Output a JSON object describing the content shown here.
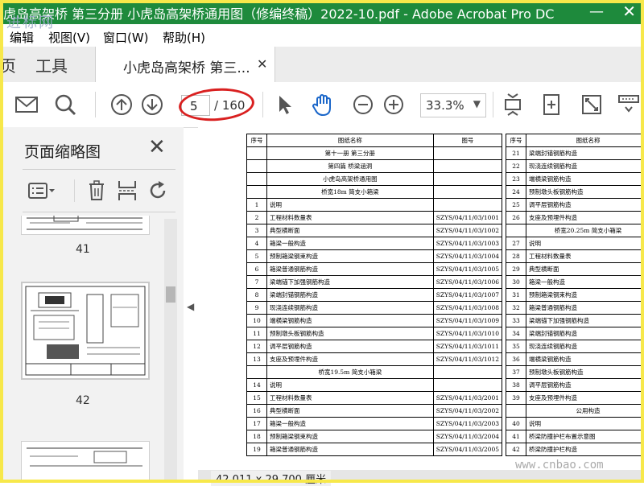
{
  "window": {
    "title": "虎岛高架桥 第三分册 小虎岛高架桥通用图（修编终稿）2022-10.pdf - Adobe Acrobat Pro DC",
    "watermark": "进标网"
  },
  "menu": [
    "编辑",
    "视图(V)",
    "窗口(W)",
    "帮助(H)"
  ],
  "tabs": {
    "home_fragment": "页",
    "tools": "工具",
    "document": "小虎岛高架桥 第三..."
  },
  "toolbar": {
    "page_current": "5",
    "page_total": "/ 160",
    "zoom": "33.3%"
  },
  "sidebar": {
    "title": "页面缩略图",
    "thumbnails": [
      "41",
      "42"
    ]
  },
  "document": {
    "header": "图纸名称",
    "header_code": "图号",
    "header_seq": "序号",
    "left_rows": [
      {
        "seq": "",
        "name": "第十一册  第三分册",
        "code": "",
        "bold": true
      },
      {
        "seq": "",
        "name": "第四篇  桥梁涵洞",
        "code": "",
        "bold": true
      },
      {
        "seq": "",
        "name": "小虎岛高架桥通用图",
        "code": "",
        "bold": true
      },
      {
        "seq": "",
        "name": "桥宽18m 简支小箱梁",
        "code": "",
        "bold": true
      },
      {
        "seq": "1",
        "name": "说明",
        "code": ""
      },
      {
        "seq": "2",
        "name": "工程材料数量表",
        "code": "SZYS/04/11/03/1001"
      },
      {
        "seq": "3",
        "name": "典型横断面",
        "code": "SZYS/04/11/03/1002"
      },
      {
        "seq": "4",
        "name": "箱梁一般构造",
        "code": "SZYS/04/11/03/1003"
      },
      {
        "seq": "5",
        "name": "预制箱梁钢束构造",
        "code": "SZYS/04/11/03/1004"
      },
      {
        "seq": "6",
        "name": "箱梁普通钢筋构造",
        "code": "SZYS/04/11/03/1005"
      },
      {
        "seq": "7",
        "name": "梁端锚下加强钢筋构造",
        "code": "SZYS/04/11/03/1006"
      },
      {
        "seq": "8",
        "name": "梁端封锚钢筋构造",
        "code": "SZYS/04/11/03/1007"
      },
      {
        "seq": "9",
        "name": "现浇连续钢筋构造",
        "code": "SZYS/04/11/03/1008"
      },
      {
        "seq": "10",
        "name": "端横梁钢筋构造",
        "code": "SZYS/04/11/03/1009"
      },
      {
        "seq": "11",
        "name": "预制墩头板钢筋构造",
        "code": "SZYS/04/11/03/1010"
      },
      {
        "seq": "12",
        "name": "调平层钢筋构造",
        "code": "SZYS/04/11/03/1011"
      },
      {
        "seq": "13",
        "name": "支座及预埋件构造",
        "code": "SZYS/04/11/03/1012"
      },
      {
        "seq": "",
        "name": "桥宽19.5m 简支小箱梁",
        "code": "",
        "bold": true
      },
      {
        "seq": "14",
        "name": "说明",
        "code": ""
      },
      {
        "seq": "15",
        "name": "工程材料数量表",
        "code": "SZYS/04/11/03/2001"
      },
      {
        "seq": "16",
        "name": "典型横断面",
        "code": "SZYS/04/11/03/2002"
      },
      {
        "seq": "17",
        "name": "箱梁一般构造",
        "code": "SZYS/04/11/03/2003"
      },
      {
        "seq": "18",
        "name": "预制箱梁钢束构造",
        "code": "SZYS/04/11/03/2004"
      },
      {
        "seq": "19",
        "name": "箱梁普通钢筋构造",
        "code": "SZYS/04/11/03/2005"
      }
    ],
    "right_rows": [
      {
        "seq": "21",
        "name": "梁端封锚钢筋构造"
      },
      {
        "seq": "22",
        "name": "现浇连续钢筋构造"
      },
      {
        "seq": "23",
        "name": "端横梁钢筋构造"
      },
      {
        "seq": "24",
        "name": "预制墩头板钢筋构造"
      },
      {
        "seq": "25",
        "name": "调平层钢筋构造"
      },
      {
        "seq": "26",
        "name": "支座及预埋件构造"
      },
      {
        "seq": "",
        "name": "桥宽20.25m 简支小箱梁",
        "bold": true
      },
      {
        "seq": "27",
        "name": "说明"
      },
      {
        "seq": "28",
        "name": "工程材料数量表"
      },
      {
        "seq": "29",
        "name": "典型横断面"
      },
      {
        "seq": "30",
        "name": "箱梁一般构造"
      },
      {
        "seq": "31",
        "name": "预制箱梁钢束构造"
      },
      {
        "seq": "32",
        "name": "箱梁普通钢筋构造"
      },
      {
        "seq": "33",
        "name": "梁端锚下加强钢筋构造"
      },
      {
        "seq": "34",
        "name": "梁端封锚钢筋构造"
      },
      {
        "seq": "35",
        "name": "现浇连续钢筋构造"
      },
      {
        "seq": "36",
        "name": "端横梁钢筋构造"
      },
      {
        "seq": "37",
        "name": "预制墩头板钢筋构造"
      },
      {
        "seq": "38",
        "name": "调平层钢筋构造"
      },
      {
        "seq": "39",
        "name": "支座及预埋件构造"
      },
      {
        "seq": "",
        "name": "公用构造",
        "bold": true
      },
      {
        "seq": "40",
        "name": "说明"
      },
      {
        "seq": "41",
        "name": "桥梁防撞护栏布置示意图"
      },
      {
        "seq": "42",
        "name": "桥梁防撞护栏构造"
      }
    ]
  },
  "status": {
    "dimensions": "42.011 x 29.700 厘米",
    "site": "www.cnbao.com"
  },
  "colors": {
    "titlebar": "#1e8a3c",
    "highlight_circle": "#d92020",
    "frame": "#f7e84a"
  }
}
